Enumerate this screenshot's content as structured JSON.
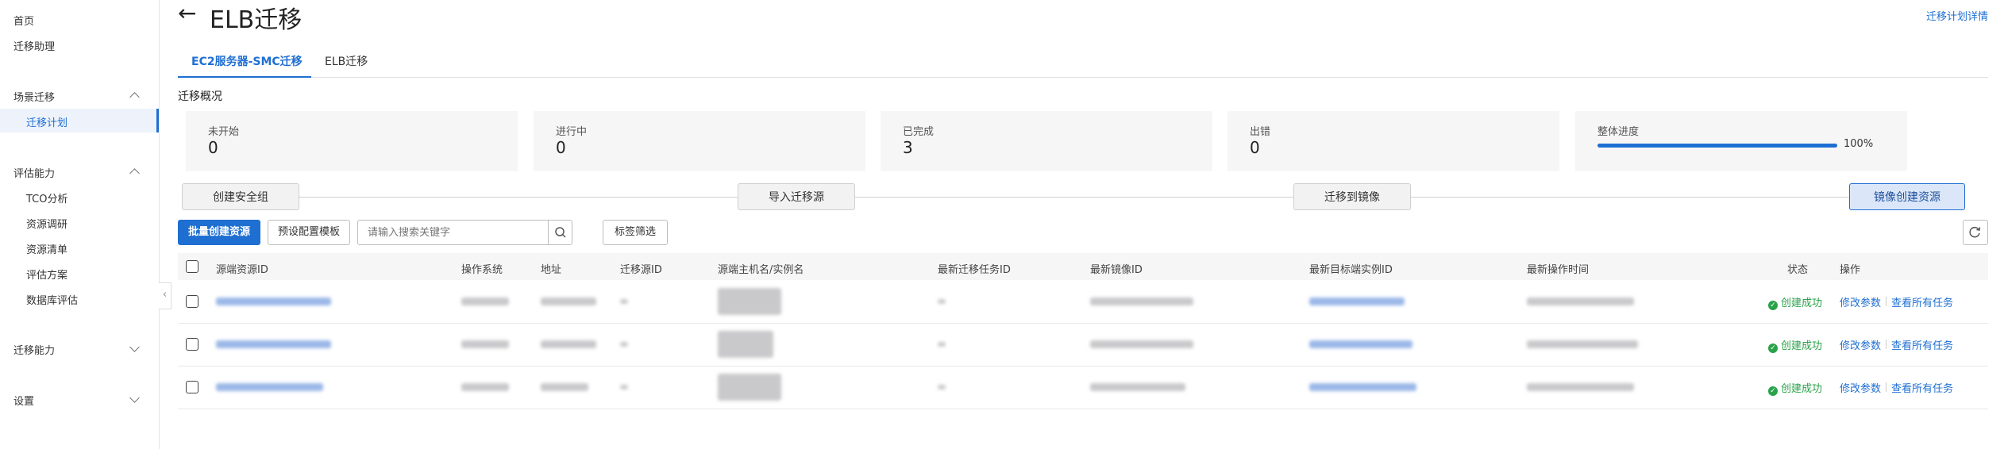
{
  "sidebar": {
    "items": [
      {
        "label": "首页"
      },
      {
        "label": "迁移助理"
      },
      {
        "label": "场景迁移"
      },
      {
        "label": "迁移计划"
      },
      {
        "label": "评估能力"
      },
      {
        "label": "TCO分析"
      },
      {
        "label": "资源调研"
      },
      {
        "label": "资源清单"
      },
      {
        "label": "评估方案"
      },
      {
        "label": "数据库评估"
      },
      {
        "label": "迁移能力"
      },
      {
        "label": "设置"
      }
    ],
    "active": "迁移计划"
  },
  "header": {
    "title": "ELB迁移",
    "detail_link": "迁移计划详情"
  },
  "tabs": [
    {
      "label": "EC2服务器-SMC迁移",
      "active": true
    },
    {
      "label": "ELB迁移",
      "active": false
    }
  ],
  "overview": {
    "title": "迁移概况",
    "cards": [
      {
        "label": "未开始",
        "value": "0"
      },
      {
        "label": "进行中",
        "value": "0"
      },
      {
        "label": "已完成",
        "value": "3"
      },
      {
        "label": "出错",
        "value": "0"
      }
    ],
    "progress": {
      "label": "整体进度",
      "percent_text": "100%",
      "fraction": 1.0
    }
  },
  "steps": [
    "创建安全组",
    "导入迁移源",
    "迁移到镜像",
    "镜像创建资源"
  ],
  "toolbar": {
    "batch_create": "批量创建资源",
    "preset_template": "预设配置模板",
    "search_placeholder": "请输入搜索关键字",
    "tag_filter": "标签筛选"
  },
  "table": {
    "columns": [
      "源端资源ID",
      "操作系统",
      "地址",
      "迁移源ID",
      "源端主机名/实例名",
      "最新迁移任务ID",
      "最新镜像ID",
      "最新目标端实例ID",
      "最新操作时间",
      "状态",
      "操作"
    ],
    "rows": [
      {
        "status": "创建成功",
        "actions": [
          "修改参数",
          "查看所有任务"
        ]
      },
      {
        "status": "创建成功",
        "actions": [
          "修改参数",
          "查看所有任务"
        ]
      },
      {
        "status": "创建成功",
        "actions": [
          "修改参数",
          "查看所有任务"
        ]
      }
    ]
  },
  "colors": {
    "accent": "#1f6fd2",
    "success": "#2aa24a"
  }
}
